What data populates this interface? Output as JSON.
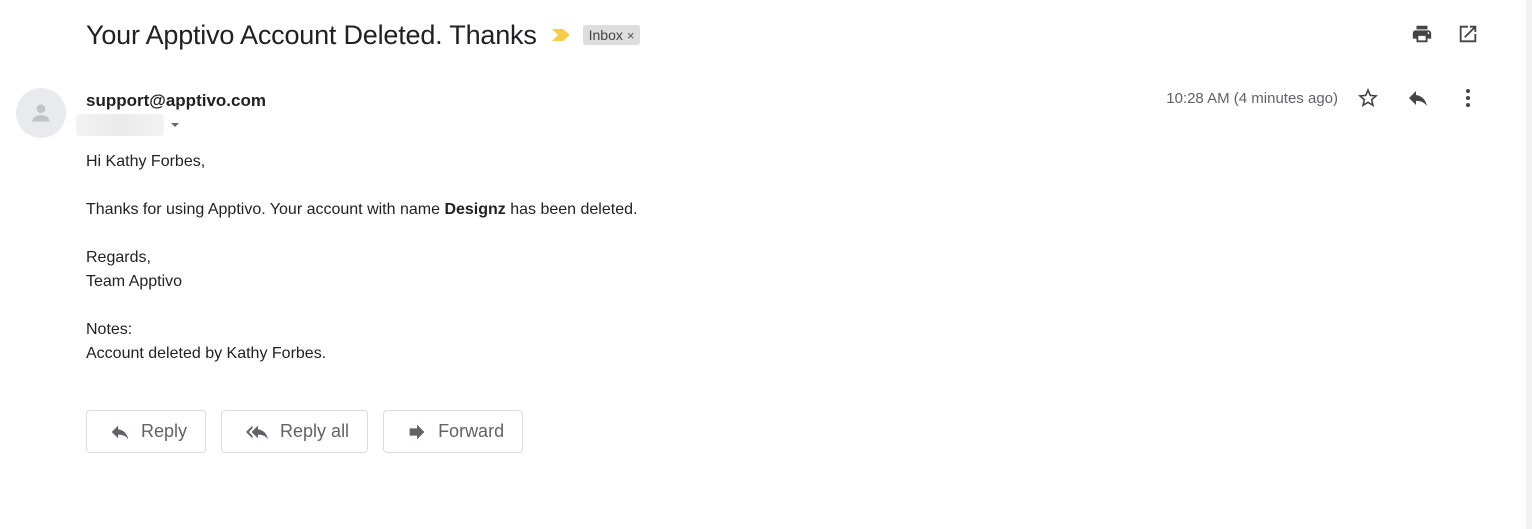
{
  "email": {
    "subject": "Your Apptivo Account Deleted. Thanks",
    "label": "Inbox",
    "label_close": "×",
    "sender": "support@apptivo.com",
    "timestamp": "10:28 AM (4 minutes ago)",
    "body": {
      "greeting": "Hi Kathy Forbes,",
      "line_prefix": "Thanks for using Apptivo. Your account with name ",
      "line_bold": "Designz",
      "line_suffix": " has been deleted.",
      "regards": "Regards,",
      "team": "Team Apptivo",
      "notes_label": "Notes:",
      "notes_text": "Account deleted by Kathy Forbes."
    }
  },
  "actions": {
    "reply": "Reply",
    "reply_all": "Reply all",
    "forward": "Forward"
  },
  "icons": {
    "importance": "importance-marker-icon",
    "print": "print-icon",
    "open_new": "open-in-new-window-icon",
    "star": "star-icon",
    "reply": "reply-icon",
    "more": "more-vertical-icon",
    "recipients_toggle": "chevron-down-icon",
    "avatar": "person-icon"
  },
  "colors": {
    "importance": "#f7cb4d",
    "label_bg": "#dddddd",
    "icon_gray": "#5f6368",
    "icon_dark": "#444444"
  }
}
